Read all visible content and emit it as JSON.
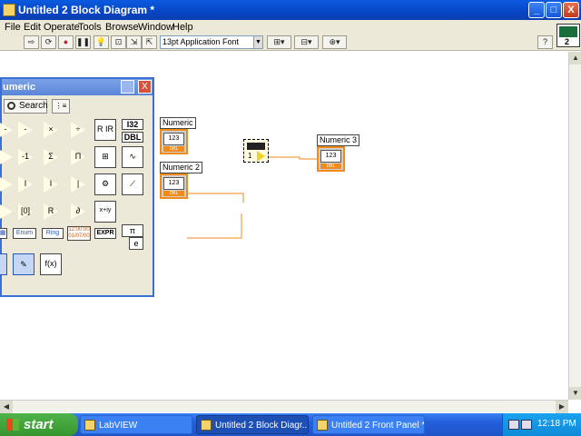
{
  "window": {
    "title": "Untitled 2 Block Diagram *",
    "controls": {
      "minimize": "_",
      "maximize": "□",
      "close": "X"
    }
  },
  "menu": [
    "File",
    "Edit",
    "Operate",
    "Tools",
    "Browse",
    "Window",
    "Help"
  ],
  "toolbar": {
    "font": "13pt Application Font",
    "vi_icon_number": "2"
  },
  "palette": {
    "title": "umeric",
    "search_label": "Search",
    "row1": [
      "-",
      "×",
      "÷",
      "R IR",
      "I32",
      "DBL"
    ],
    "row2": [
      "-1",
      "Σ",
      "Π",
      "⊞"
    ],
    "row3": [
      "I",
      "I",
      "|",
      "⟋"
    ],
    "row4": [
      "[0]",
      "R",
      "∂",
      "x+iy"
    ],
    "row5": [
      "Enum",
      "Ring",
      "12:00:00 01/07/00",
      "EXPR",
      "π",
      "e"
    ],
    "row6": [
      "f(x)"
    ]
  },
  "diagram": {
    "numeric1": {
      "label": "Numeric",
      "value": "123",
      "type": "DBL"
    },
    "numeric2": {
      "label": "Numeric 2",
      "value": "123",
      "type": "DBL"
    },
    "numeric3": {
      "label": "Numeric 3",
      "value": "123",
      "type": "DBL"
    },
    "add_node_value": "1"
  },
  "taskbar": {
    "start_label": "start",
    "tasks": [
      "LabVIEW",
      "Untitled 2 Block Diagr...",
      "Untitled 2 Front Panel *"
    ],
    "clock": "12:18 PM"
  }
}
